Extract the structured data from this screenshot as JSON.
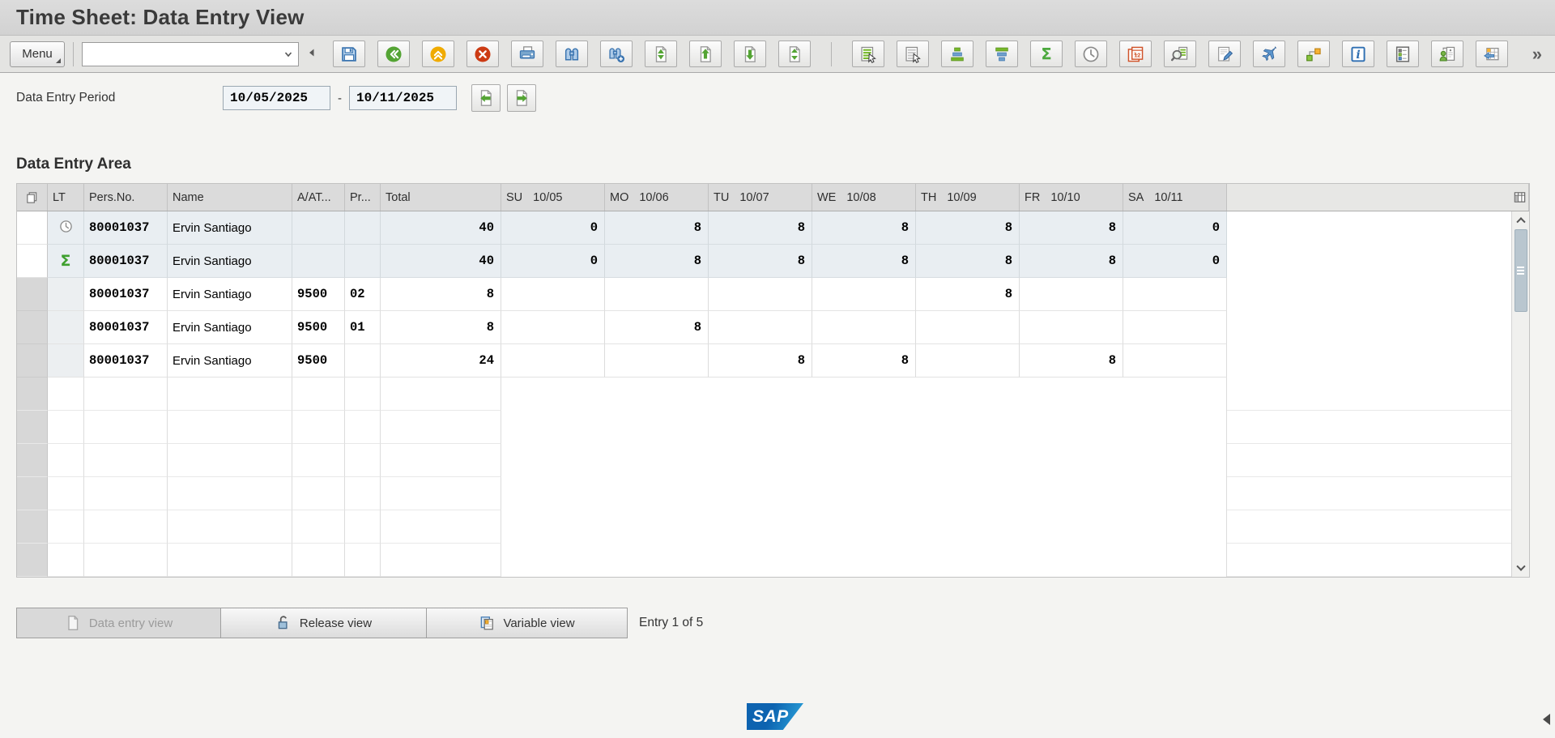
{
  "window": {
    "title": "Time Sheet: Data Entry View"
  },
  "toolbar": {
    "menu_label": "Menu",
    "command_field": {
      "value": ""
    },
    "overflow_label": "»",
    "icons": [
      "save-icon",
      "back-icon",
      "up-icon",
      "exit-icon",
      "print-icon",
      "find-icon",
      "find-next-icon",
      "first-page-icon",
      "page-up-icon",
      "page-down-icon",
      "last-page-icon",
      "choose-icon",
      "save-as-variant-icon",
      "sort-ascending-icon",
      "sort-descending-icon",
      "sum-icon",
      "time-icon",
      "calendar-icon",
      "search-list-icon",
      "edit-icon",
      "travel-icon",
      "assignment-icon",
      "info-icon",
      "legend-icon",
      "personnel-icon",
      "table-import-icon"
    ]
  },
  "period": {
    "label": "Data Entry Period",
    "from_date": "10/05/2025",
    "separator": "-",
    "to_date": "10/11/2025",
    "nav_icons": [
      "previous-period-icon",
      "next-period-icon"
    ]
  },
  "section_title": "Data Entry Area",
  "table": {
    "corner_icon": "select-all-icon",
    "config_icon": "table-settings-icon",
    "columns": {
      "lt": "LT",
      "persno": "Pers.No.",
      "name": "Name",
      "aat": "A/AT...",
      "pr": "Pr...",
      "total": "Total"
    },
    "day_columns": [
      {
        "day": "SU",
        "date": "10/05"
      },
      {
        "day": "MO",
        "date": "10/06"
      },
      {
        "day": "TU",
        "date": "10/07"
      },
      {
        "day": "WE",
        "date": "10/08"
      },
      {
        "day": "TH",
        "date": "10/09"
      },
      {
        "day": "FR",
        "date": "10/10"
      },
      {
        "day": "SA",
        "date": "10/11"
      }
    ],
    "rows": [
      {
        "style": "summary",
        "lt_icon": "clock-icon",
        "persno": "80001037",
        "name": "Ervin Santiago",
        "aat": "",
        "pr": "",
        "total": "40",
        "days": [
          "0",
          "8",
          "8",
          "8",
          "8",
          "8",
          "0"
        ]
      },
      {
        "style": "summary",
        "lt_icon": "sum-icon",
        "persno": "80001037",
        "name": "Ervin Santiago",
        "aat": "",
        "pr": "",
        "total": "40",
        "days": [
          "0",
          "8",
          "8",
          "8",
          "8",
          "8",
          "0"
        ]
      },
      {
        "style": "data",
        "lt_icon": "",
        "persno": "80001037",
        "name": "Ervin Santiago",
        "aat": "9500",
        "pr": "02",
        "total": "8",
        "days": [
          "",
          "",
          "",
          "",
          "8",
          "",
          ""
        ]
      },
      {
        "style": "data",
        "lt_icon": "",
        "persno": "80001037",
        "name": "Ervin Santiago",
        "aat": "9500",
        "pr": "01",
        "total": "8",
        "days": [
          "",
          "8",
          "",
          "",
          "",
          "",
          ""
        ]
      },
      {
        "style": "data",
        "lt_icon": "",
        "persno": "80001037",
        "name": "Ervin Santiago",
        "aat": "9500",
        "pr": "",
        "total": "24",
        "days": [
          "",
          "",
          "8",
          "8",
          "",
          "8",
          ""
        ]
      }
    ],
    "empty_row_count": 6
  },
  "footer": {
    "buttons": [
      {
        "label": "Data entry view",
        "icon": "page-icon",
        "disabled": true
      },
      {
        "label": "Release view",
        "icon": "unlock-icon",
        "disabled": false
      },
      {
        "label": "Variable view",
        "icon": "variable-view-icon",
        "disabled": false
      }
    ],
    "entry_status": "Entry 1 of 5"
  },
  "branding": {
    "logo_text": "SAP"
  },
  "colors": {
    "accent_green": "#54a434",
    "accent_orange": "#f0ab00",
    "accent_red": "#cc3b14",
    "accent_blue": "#3a74b0",
    "summary_row_bg": "#e9eef2",
    "header_bg": "#dbdbdb"
  }
}
